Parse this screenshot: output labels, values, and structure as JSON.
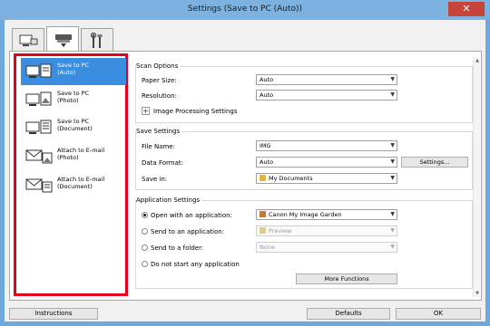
{
  "window": {
    "title": "Settings (Save to PC (Auto))",
    "close_glyph": "✕"
  },
  "tabs": [
    {
      "icon": "computer-scan-icon"
    },
    {
      "icon": "scanner-icon",
      "active": true
    },
    {
      "icon": "tools-icon"
    }
  ],
  "sidebar": {
    "items": [
      {
        "label": "Save to PC\n(Auto)",
        "icon": "save-to-pc-icon",
        "selected": true
      },
      {
        "label": "Save to PC\n(Photo)",
        "icon": "save-to-pc-photo-icon"
      },
      {
        "label": "Save to PC\n(Document)",
        "icon": "save-to-pc-document-icon"
      },
      {
        "label": "Attach to E-mail\n(Photo)",
        "icon": "email-photo-icon"
      },
      {
        "label": "Attach to E-mail\n(Document)",
        "icon": "email-document-icon"
      }
    ]
  },
  "scan_options": {
    "title": "Scan Options",
    "paper_size_label": "Paper Size:",
    "paper_size_value": "Auto",
    "resolution_label": "Resolution:",
    "resolution_value": "Auto",
    "image_processing_label": "Image Processing Settings",
    "plus_glyph": "+"
  },
  "save_settings": {
    "title": "Save Settings",
    "file_name_label": "File Name:",
    "file_name_value": "IMG",
    "data_format_label": "Data Format:",
    "data_format_value": "Auto",
    "settings_button": "Settings...",
    "save_in_label": "Save in:",
    "save_in_value": "My Documents"
  },
  "application_settings": {
    "title": "Application Settings",
    "open_with_label": "Open with an application:",
    "open_with_value": "Canon My Image Garden",
    "send_to_app_label": "Send to an application:",
    "send_to_app_value": "Preview",
    "send_to_folder_label": "Send to a folder:",
    "send_to_folder_value": "None",
    "do_not_start_label": "Do not start any application",
    "more_functions_button": "More Functions"
  },
  "footer": {
    "instructions": "Instructions",
    "defaults": "Defaults",
    "ok": "OK"
  },
  "colors": {
    "selection": "#3b8de0",
    "highlight_border": "#e3001b",
    "titlebar": "#7db2e0",
    "close": "#c7443a"
  }
}
